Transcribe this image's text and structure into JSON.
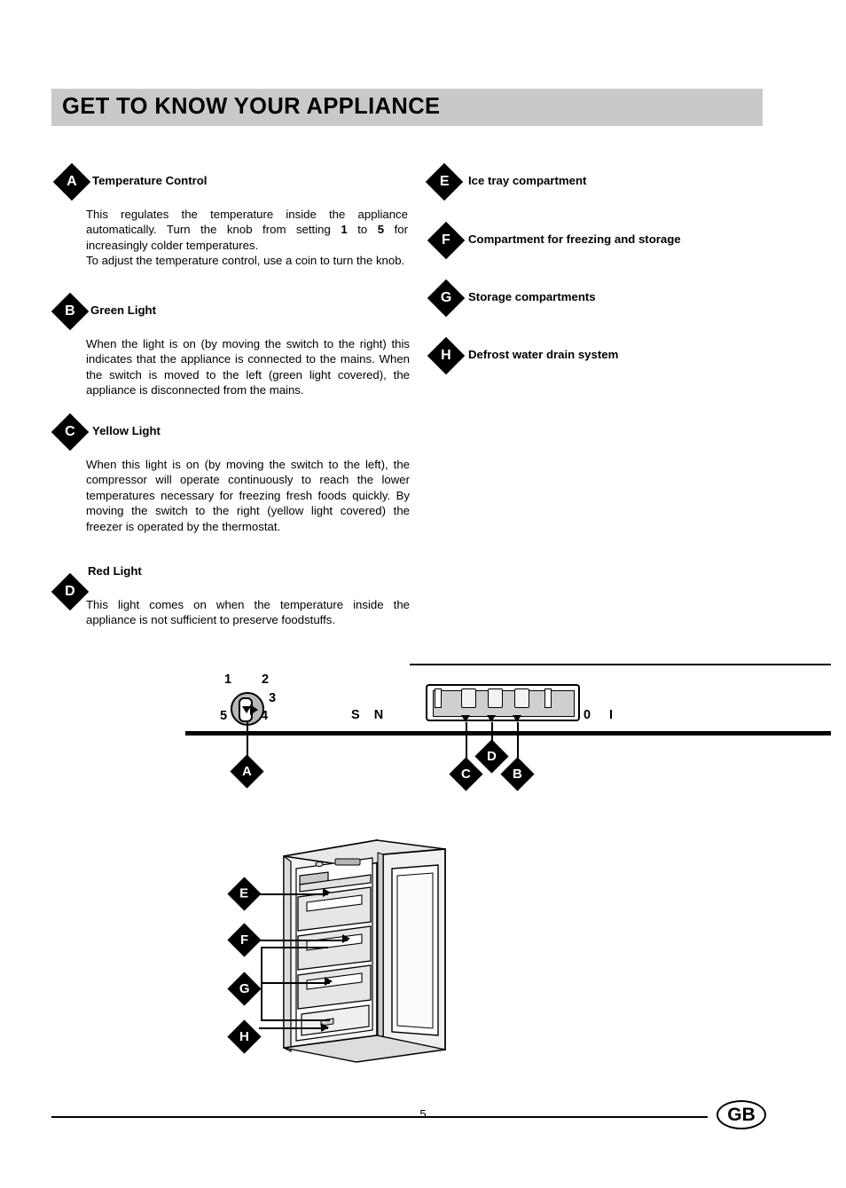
{
  "header": {
    "title": "GET TO KNOW YOUR APPLIANCE"
  },
  "left_entries": [
    {
      "letter": "A",
      "title": "Temperature Control",
      "body_parts": [
        "This regulates the temperature inside the appliance automatically. Turn the knob from setting ",
        "1",
        " to ",
        "5",
        " for increasingly colder temperatures.",
        "To adjust the temperature control, use a coin to turn the knob."
      ]
    },
    {
      "letter": "B",
      "title": "Green Light",
      "body": "When the light is on (by moving the switch to the right) this indicates that the appliance is connected to the mains. When the switch is moved to the left (green light covered), the appliance is disconnected from the mains."
    },
    {
      "letter": "C",
      "title": "Yellow Light",
      "body": "When this light is on (by moving the switch to the left), the compressor will operate continuously to reach the lower temperatures necessary for freezing fresh foods quickly. By moving the switch to the right (yellow light covered) the freezer is operated by the thermostat."
    },
    {
      "letter": "D",
      "title": "Red Light",
      "body": "This light comes on when the temperature inside the appliance is not sufficient to preserve foodstuffs."
    }
  ],
  "right_entries": [
    {
      "letter": "E",
      "title": "Ice tray compartment"
    },
    {
      "letter": "F",
      "title": "Compartment for freezing and storage"
    },
    {
      "letter": "G",
      "title": "Storage compartments"
    },
    {
      "letter": "H",
      "title": "Defrost water drain system"
    }
  ],
  "panel": {
    "dial_numbers": [
      "1",
      "2",
      "3",
      "4",
      "5"
    ],
    "sn_label": "S N",
    "zero_label": "0",
    "one_label": "I",
    "callouts": [
      "A",
      "C",
      "D",
      "B"
    ]
  },
  "fridge": {
    "callouts": [
      "E",
      "F",
      "G",
      "H"
    ]
  },
  "footer": {
    "page_number": "5",
    "region_badge": "GB"
  }
}
